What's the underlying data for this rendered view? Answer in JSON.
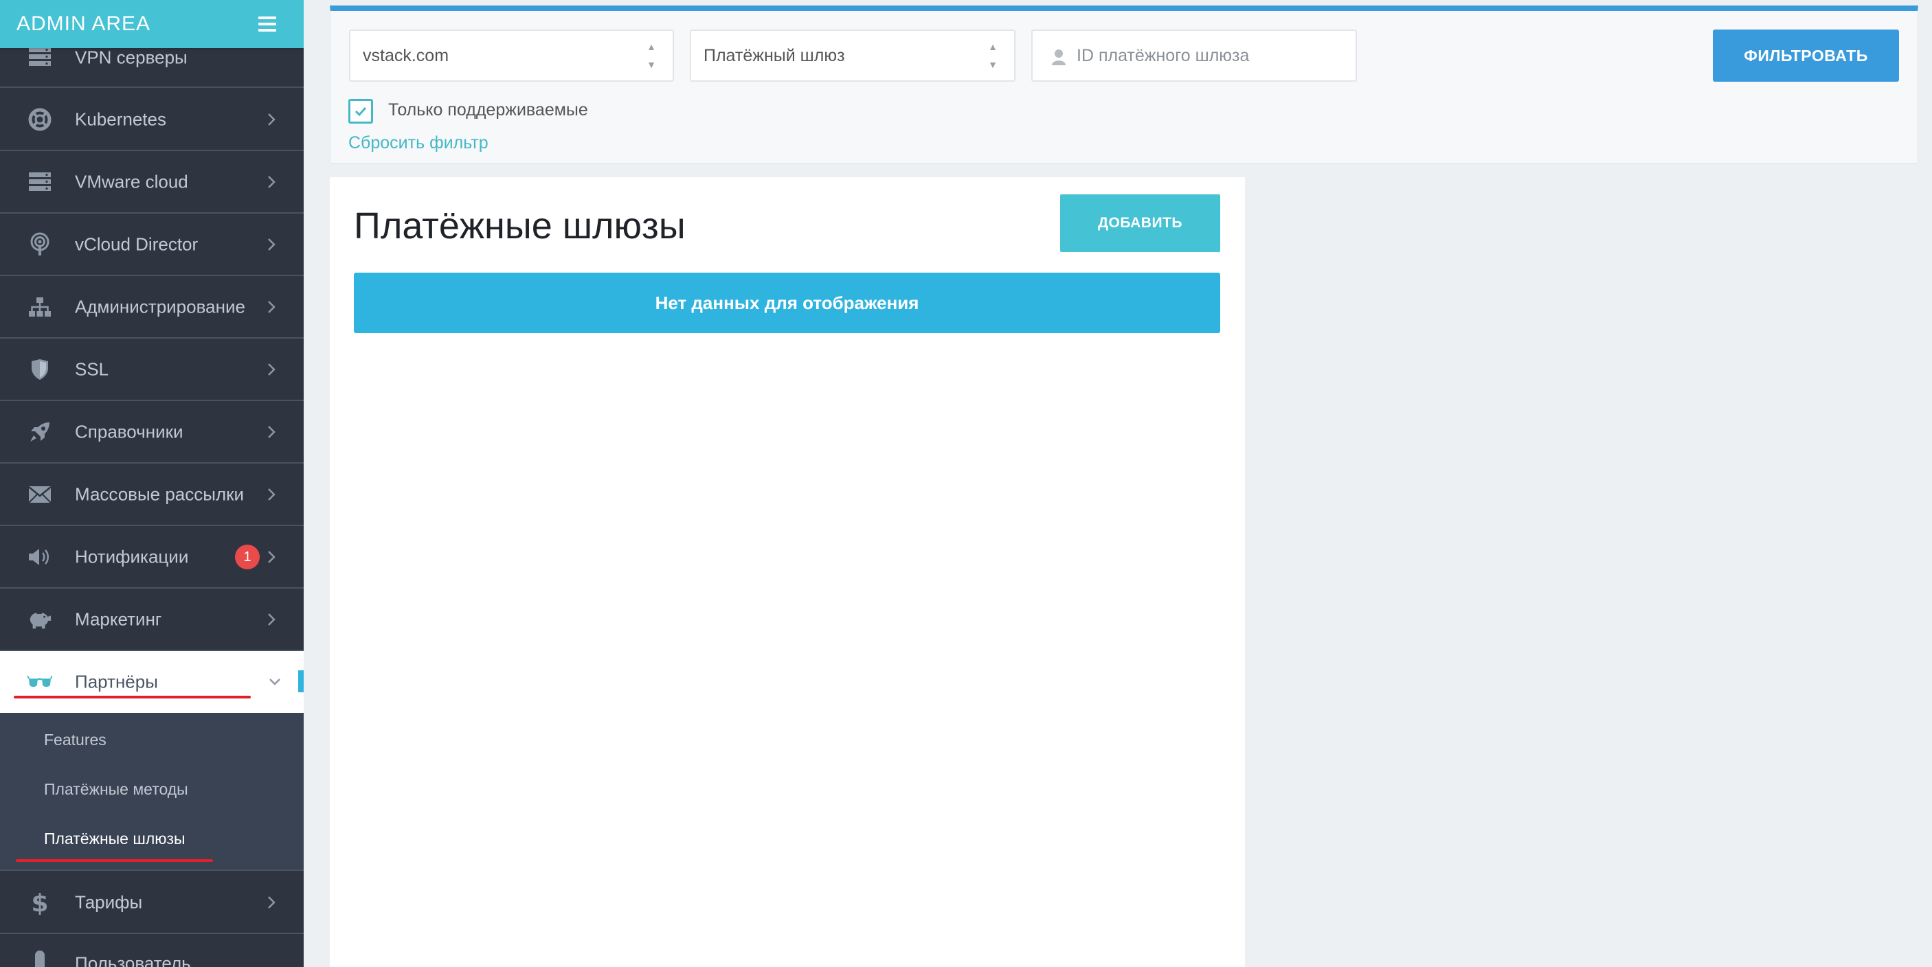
{
  "brand": {
    "title": "ADMIN AREA"
  },
  "sidebar": {
    "items": [
      {
        "label": "VPN серверы",
        "icon": "server-icon"
      },
      {
        "label": "Kubernetes",
        "icon": "lifebuoy-icon"
      },
      {
        "label": "VMware cloud",
        "icon": "server-icon"
      },
      {
        "label": "vCloud Director",
        "icon": "podcast-icon"
      },
      {
        "label": "Администрирование",
        "icon": "sitemap-icon"
      },
      {
        "label": "SSL",
        "icon": "shield-icon"
      },
      {
        "label": "Справочники",
        "icon": "rocket-icon"
      },
      {
        "label": "Массовые рассылки",
        "icon": "envelope-icon"
      },
      {
        "label": "Нотификации",
        "icon": "megaphone-icon",
        "badge": "1"
      },
      {
        "label": "Маркетинг",
        "icon": "piggy-bank-icon"
      },
      {
        "label": "Партнёры",
        "icon": "glasses-icon",
        "expanded": true
      },
      {
        "label": "Тарифы",
        "icon": "dollar-icon"
      },
      {
        "label": "Пользователь",
        "icon": "user-icon"
      }
    ],
    "submenu": [
      {
        "label": "Features"
      },
      {
        "label": "Платёжные методы"
      },
      {
        "label": "Платёжные шлюзы",
        "current": true
      }
    ]
  },
  "filter": {
    "domain_select": "vstack.com",
    "gateway_select": "Платёжный шлюз",
    "gateway_id_placeholder": "ID платёжного шлюза",
    "filter_button": "ФИЛЬТРОВАТЬ",
    "only_supported_label": "Только поддерживаемые",
    "only_supported_checked": true,
    "reset_link": "Сбросить фильтр"
  },
  "main": {
    "title": "Платёжные шлюзы",
    "add_button": "ДОБАВИТЬ",
    "empty_message": "Нет данных для отображения"
  },
  "colors": {
    "accent": "#45c2d3",
    "primary": "#3a9bdc",
    "info": "#2fb3df",
    "sidebar_bg": "#2e3541",
    "badge": "#e94b4b",
    "annotation_red": "#e0212a"
  }
}
